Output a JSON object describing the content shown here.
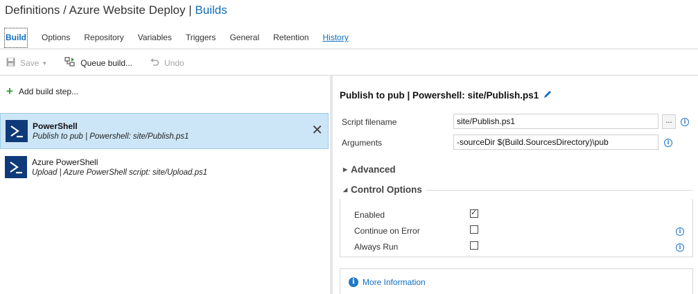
{
  "breadcrumb": {
    "root": "Definitions",
    "separator": "/",
    "definition": "Azure Website Deploy",
    "pipe": "|",
    "current": "Builds"
  },
  "tabs": [
    {
      "label": "Build",
      "active": true
    },
    {
      "label": "Options"
    },
    {
      "label": "Repository"
    },
    {
      "label": "Variables"
    },
    {
      "label": "Triggers"
    },
    {
      "label": "General"
    },
    {
      "label": "Retention"
    },
    {
      "label": "History",
      "link": true
    }
  ],
  "toolbar": {
    "save_label": "Save",
    "save_icon": "floppy-disk-icon",
    "queue_label": "Queue build...",
    "queue_icon": "queue-build-icon",
    "undo_label": "Undo",
    "undo_icon": "undo-icon"
  },
  "left_panel": {
    "add_step_label": "Add build step...",
    "steps": [
      {
        "name": "PowerShell",
        "description": "Publish to pub | Powershell: site/Publish.ps1",
        "selected": true,
        "icon": "powershell-icon"
      },
      {
        "name": "Azure PowerShell",
        "description": "Upload | Azure PowerShell script: site/Upload.ps1",
        "selected": false,
        "icon": "powershell-icon"
      }
    ]
  },
  "right_panel": {
    "title": "Publish to pub | Powershell: site/Publish.ps1",
    "fields": {
      "script_filename_label": "Script filename",
      "script_filename_value": "site/Publish.ps1",
      "browse_label": "...",
      "arguments_label": "Arguments",
      "arguments_value": "-sourceDir $(Build.SourcesDirectory)\\pub"
    },
    "advanced_label": "Advanced",
    "control_options_label": "Control Options",
    "control_options": [
      {
        "label": "Enabled",
        "checked": true
      },
      {
        "label": "Continue on Error",
        "checked": false
      },
      {
        "label": "Always Run",
        "checked": false
      }
    ],
    "more_information_label": "More Information"
  },
  "colors": {
    "accent": "#106ebe",
    "selected_row": "#cde6f7",
    "powershell_tile": "#0f3a7a",
    "add_green": "#3a9a3a"
  }
}
